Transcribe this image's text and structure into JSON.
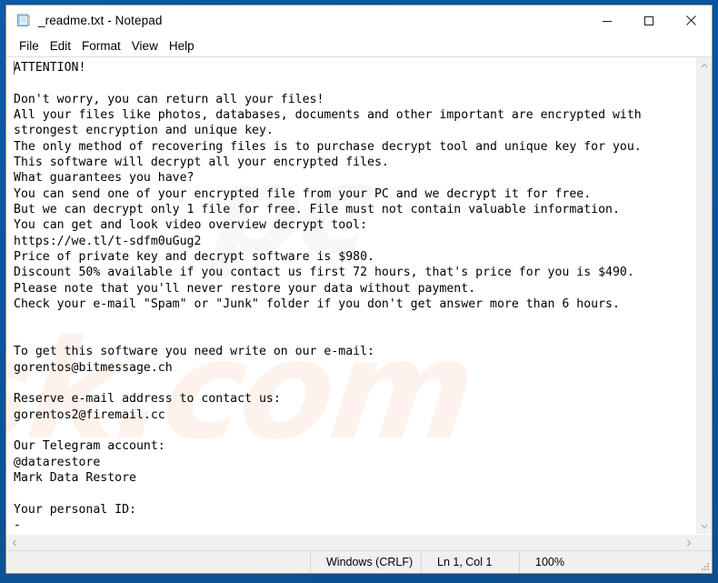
{
  "window": {
    "title": "_readme.txt - Notepad",
    "icon": "notepad-document-icon",
    "controls": {
      "minimize": "Minimize",
      "maximize": "Maximize",
      "close": "Close"
    }
  },
  "menubar": {
    "items": [
      {
        "label": "File"
      },
      {
        "label": "Edit"
      },
      {
        "label": "Format"
      },
      {
        "label": "View"
      },
      {
        "label": "Help"
      }
    ]
  },
  "document": {
    "filename": "_readme.txt",
    "body": "ATTENTION!\n\nDon't worry, you can return all your files!\nAll your files like photos, databases, documents and other important are encrypted with\nstrongest encryption and unique key.\nThe only method of recovering files is to purchase decrypt tool and unique key for you.\nThis software will decrypt all your encrypted files.\nWhat guarantees you have?\nYou can send one of your encrypted file from your PC and we decrypt it for free.\nBut we can decrypt only 1 file for free. File must not contain valuable information.\nYou can get and look video overview decrypt tool:\nhttps://we.tl/t-sdfm0uGug2\nPrice of private key and decrypt software is $980.\nDiscount 50% available if you contact us first 72 hours, that's price for you is $490.\nPlease note that you'll never restore your data without payment.\nCheck your e-mail \"Spam\" or \"Junk\" folder if you don't get answer more than 6 hours.\n\n\nTo get this software you need write on our e-mail:\ngorentos@bitmessage.ch\n\nReserve e-mail address to contact us:\ngorentos2@firemail.cc\n\nOur Telegram account:\n@datarestore\nMark Data Restore\n\nYour personal ID:\n-",
    "details": {
      "heading": "ATTENTION!",
      "video_url": "https://we.tl/t-sdfm0uGug2",
      "price": "$980",
      "discount_price": "$490",
      "discount_percent": "50%",
      "discount_window": "72 hours",
      "answer_window": "6 hours",
      "primary_email": "gorentos@bitmessage.ch",
      "reserve_email": "gorentos2@firemail.cc",
      "telegram_account": "@datarestore",
      "telegram_name": "Mark Data Restore",
      "personal_id": "-"
    }
  },
  "watermark": {
    "line1": "sk.com",
    "line2": "pc"
  },
  "statusbar": {
    "line_ending": "Windows (CRLF)",
    "cursor_position": "Ln 1, Col 1",
    "zoom": "100%"
  },
  "scrollbars": {
    "vertical_up": "scroll-up",
    "vertical_down": "scroll-down",
    "horizontal_left": "scroll-left",
    "horizontal_right": "scroll-right"
  },
  "colors": {
    "desktop": "#0a5cab",
    "window_bg": "#ffffff",
    "chrome": "#f0f0f0",
    "text": "#000000"
  }
}
